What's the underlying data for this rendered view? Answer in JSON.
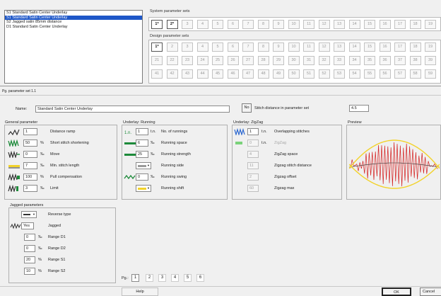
{
  "pattern_list": [
    {
      "label": "S1 Standard Satin Center Underlay",
      "selected": false
    },
    {
      "label": "S1 Standard Satin Center Underlay",
      "selected": true
    },
    {
      "label": "S2 Jagged satin 85mm distance",
      "selected": false
    },
    {
      "label": "D1 Standard Satin Center Underlay",
      "selected": false
    }
  ],
  "system_sets": {
    "label": "System parameter sets",
    "buttons": [
      {
        "label": "1*",
        "active": true
      },
      {
        "label": "2*",
        "active": true
      },
      {
        "label": "3",
        "active": false
      },
      {
        "label": "4",
        "active": false
      },
      {
        "label": "5",
        "active": false
      },
      {
        "label": "6",
        "active": false
      },
      {
        "label": "7",
        "active": false
      },
      {
        "label": "8",
        "active": false
      },
      {
        "label": "9",
        "active": false
      },
      {
        "label": "10",
        "active": false
      },
      {
        "label": "11",
        "active": false
      },
      {
        "label": "12",
        "active": false
      },
      {
        "label": "13",
        "active": false
      },
      {
        "label": "14",
        "active": false
      },
      {
        "label": "15",
        "active": false
      },
      {
        "label": "16",
        "active": false
      },
      {
        "label": "17",
        "active": false
      },
      {
        "label": "18",
        "active": false
      },
      {
        "label": "19",
        "active": false
      }
    ]
  },
  "design_sets": {
    "label": "Design parameter sets",
    "rows": [
      [
        "1*",
        "2",
        "3",
        "4",
        "5",
        "6",
        "7",
        "8",
        "9",
        "10",
        "11",
        "12",
        "13",
        "14",
        "15",
        "16",
        "17",
        "18",
        "19"
      ],
      [
        "21",
        "22",
        "23",
        "24",
        "25",
        "26",
        "27",
        "28",
        "29",
        "30",
        "31",
        "32",
        "33",
        "34",
        "35",
        "36",
        "37",
        "38",
        "39"
      ],
      [
        "41",
        "42",
        "43",
        "44",
        "45",
        "46",
        "47",
        "48",
        "49",
        "50",
        "51",
        "52",
        "53",
        "54",
        "55",
        "56",
        "57",
        "58",
        "59"
      ]
    ]
  },
  "set_caption": "Pg. parameter set 1.1",
  "name_label": "Name:",
  "name_value": "Standard Satin Center Underlay",
  "no_button": "No",
  "stitch_distance_label": "Stitch distance in parameter set",
  "stitch_distance_value": "4.5",
  "general": {
    "title": "General parameter",
    "rows": [
      {
        "icon": "distance-ramp-icon",
        "value": "1",
        "unit": "",
        "label": "Distance ramp"
      },
      {
        "icon": "short-stitch-icon",
        "value": "50",
        "unit": "%",
        "label": "Short stitch shortening"
      },
      {
        "icon": "move-icon",
        "value": "0",
        "unit": "‰",
        "label": "Move"
      },
      {
        "icon": "min-stitch-icon",
        "value": "7",
        "unit": "‰",
        "label": "Min. stitch length"
      },
      {
        "icon": "pull-comp-icon",
        "value": "100",
        "unit": "%",
        "label": "Pull compensation"
      },
      {
        "icon": "limit-icon",
        "value": "3",
        "unit": "‰",
        "label": "Limit"
      }
    ]
  },
  "running": {
    "title": "Underlay: Running",
    "rows": [
      {
        "value": "1",
        "unit": "t.n.",
        "label": "No. of runnings",
        "lead": "1.n."
      },
      {
        "value": "6",
        "unit": "‰",
        "label": "Running space",
        "lead": ""
      },
      {
        "value": "25",
        "unit": "‰",
        "label": "Running strength",
        "lead": ""
      },
      {
        "value": "",
        "unit": "",
        "label": "Running side",
        "lead": ""
      },
      {
        "value": "0",
        "unit": "‰",
        "label": "Running swing",
        "lead": ""
      },
      {
        "value": "",
        "unit": "",
        "label": "Running shift",
        "lead": ""
      }
    ]
  },
  "zigzag": {
    "title": "Underlay: ZigZag",
    "rows": [
      {
        "value": "1",
        "unit": "t.n.",
        "label": "Overlapping stitches",
        "disabled": false
      },
      {
        "value": "0",
        "unit": "t.n.",
        "label": "ZigZag",
        "disabled": true
      },
      {
        "value": "4",
        "unit": "",
        "label": "ZigZag space",
        "disabled": false
      },
      {
        "value": "11",
        "unit": "",
        "label": "Zigzag stitch distance",
        "disabled": false
      },
      {
        "value": "2",
        "unit": "",
        "label": "Zigzag offset",
        "disabled": false
      },
      {
        "value": "60",
        "unit": "",
        "label": "Zigzag max",
        "disabled": false
      }
    ]
  },
  "preview_title": "Preview",
  "jagged": {
    "title": "Jagged parameters",
    "rows": [
      {
        "value": "",
        "unit": "",
        "label": "Reverse type"
      },
      {
        "value": "Yes",
        "unit": "",
        "label": "Jagged"
      },
      {
        "value": "0",
        "unit": "‰",
        "label": "Range D1"
      },
      {
        "value": "0",
        "unit": "‰",
        "label": "Range D2"
      },
      {
        "value": "20",
        "unit": "%",
        "label": "Range S1"
      },
      {
        "value": "10",
        "unit": "%",
        "label": "Range S2"
      }
    ]
  },
  "pages": {
    "label": "Pg.:",
    "items": [
      "1",
      "2",
      "3",
      "4",
      "5",
      "6"
    ]
  },
  "help_button": "Help",
  "ok_button": "OK",
  "cancel_button": "Cancel",
  "colors": {
    "selection": "#1e57c8",
    "preview_red": "#d42020",
    "preview_yellow": "#f2d22a"
  }
}
